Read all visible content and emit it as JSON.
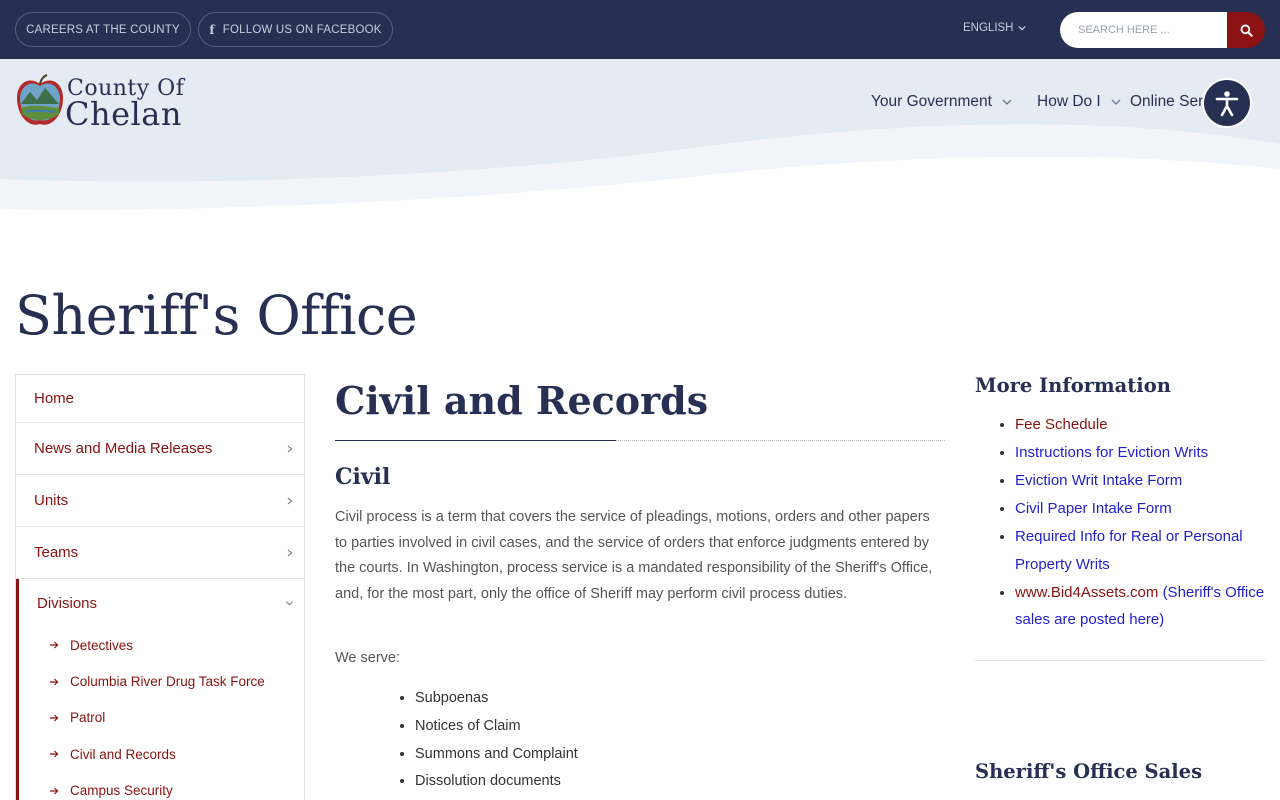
{
  "topbar": {
    "careers_label": "CAREERS AT THE COUNTY",
    "facebook_label": "FOLLOW US ON FACEBOOK",
    "language_label": "ENGLISH",
    "search_placeholder": "SEARCH HERE ..."
  },
  "header": {
    "logo_line1": "County Of",
    "logo_line2": "Chelan",
    "nav": [
      {
        "label": "Your Government"
      },
      {
        "label": "How Do I"
      },
      {
        "label": "Online Serv"
      }
    ]
  },
  "page_title": "Sheriff's Office",
  "sidebar": {
    "items": [
      {
        "label": "Home"
      },
      {
        "label": "News and Media Releases"
      },
      {
        "label": "Units"
      },
      {
        "label": "Teams"
      }
    ],
    "active": {
      "label": "Divisions",
      "children": [
        {
          "label": "Detectives"
        },
        {
          "label": "Columbia River Drug Task Force"
        },
        {
          "label": "Patrol"
        },
        {
          "label": "Civil and Records"
        },
        {
          "label": "Campus Security"
        }
      ]
    }
  },
  "main": {
    "title": "Civil and Records",
    "section_heading": "Civil",
    "paragraph": "Civil process is a term that covers the service of pleadings, motions, orders and other papers to parties involved in civil cases, and the service of orders that enforce judgments entered by the courts. In Washington, process service is a mandated responsibility of the Sheriff's Office, and, for the most part, only the office of Sheriff may perform civil process duties.",
    "we_serve_label": "We serve:",
    "serve_items": [
      "Subpoenas",
      "Notices of Claim",
      "Summons and Complaint",
      "Dissolution documents"
    ]
  },
  "right": {
    "more_heading": "More Information",
    "links": [
      {
        "label": "Fee Schedule"
      },
      {
        "label": "Instructions for Eviction Writs"
      },
      {
        "label": "Eviction Writ Intake Form"
      },
      {
        "label": "Civil Paper Intake Form"
      },
      {
        "label": "Required Info for Real or Personal Property Writs"
      },
      {
        "label": "www.Bid4Assets.com",
        "suffix": "(Sheriff's Office sales are posted here)"
      }
    ],
    "sales_heading": "Sheriff's Office Sales"
  },
  "colors": {
    "navy": "#273052",
    "accent_red": "#8a1212",
    "link_blue": "#1f1fcf",
    "header_band": "#e4ebf3"
  }
}
